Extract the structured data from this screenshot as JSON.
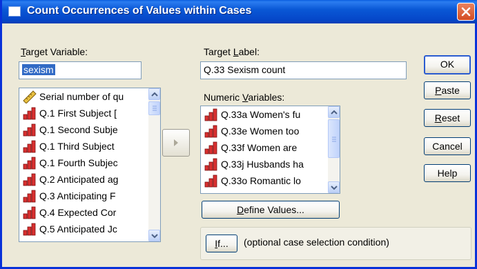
{
  "window": {
    "title": "Count Occurrences of Values within Cases"
  },
  "target_variable": {
    "label_mnemonic": "T",
    "label_rest": "arget Variable:",
    "value": "sexism"
  },
  "target_label": {
    "label_pre": "Target ",
    "label_mnemonic": "L",
    "label_rest": "abel:",
    "value": "Q.33 Sexism count"
  },
  "variables_list": {
    "items": [
      {
        "icon": "ruler-icon",
        "label": "Serial number of qu"
      },
      {
        "icon": "bar-chart-icon",
        "label": "Q.1  First Subject ["
      },
      {
        "icon": "bar-chart-icon",
        "label": "Q.1  Second Subje"
      },
      {
        "icon": "bar-chart-icon",
        "label": "Q.1  Third Subject"
      },
      {
        "icon": "bar-chart-icon",
        "label": "Q.1  Fourth Subjec"
      },
      {
        "icon": "bar-chart-icon",
        "label": "Q.2  Anticipated ag"
      },
      {
        "icon": "bar-chart-icon",
        "label": "Q.3  Anticipating F"
      },
      {
        "icon": "bar-chart-icon",
        "label": "Q.4  Expected Cor"
      },
      {
        "icon": "bar-chart-icon",
        "label": "Q.5  Anticipated Jc"
      }
    ]
  },
  "numeric_variables": {
    "label_pre": "Numeric ",
    "label_mnemonic": "V",
    "label_rest": "ariables:",
    "items": [
      {
        "icon": "bar-chart-icon",
        "label": "Q.33a Women's fu"
      },
      {
        "icon": "bar-chart-icon",
        "label": "Q.33e Women too"
      },
      {
        "icon": "bar-chart-icon",
        "label": "Q.33f Women are"
      },
      {
        "icon": "bar-chart-icon",
        "label": "Q.33j Husbands ha"
      },
      {
        "icon": "bar-chart-icon",
        "label": "Q.33o Romantic lo"
      }
    ]
  },
  "buttons": {
    "ok": "OK",
    "paste_mn": "P",
    "paste_rest": "aste",
    "reset_mn": "R",
    "reset_rest": "eset",
    "cancel": "Cancel",
    "help": "Help",
    "define_mn": "D",
    "define_rest": "efine Values...",
    "if_mn": "I",
    "if_rest": "f..."
  },
  "condition_text": "(optional case selection condition)",
  "colors": {
    "titlebar": "#0a58d6",
    "selection": "#316ac5",
    "close_button": "#d44c22"
  }
}
